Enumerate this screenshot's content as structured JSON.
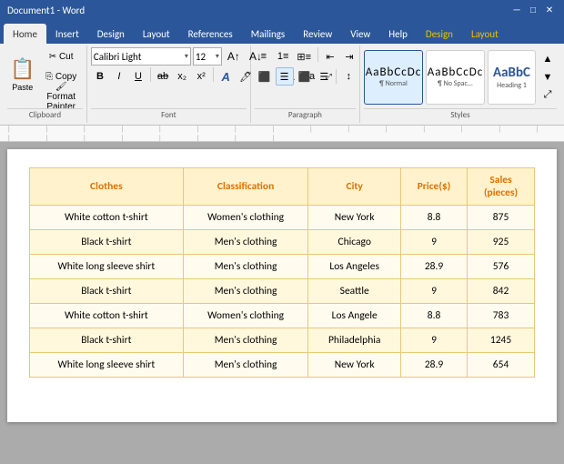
{
  "titlebar": {
    "title": "Document1 - Word",
    "controls": [
      "─",
      "□",
      "✕"
    ]
  },
  "tabs": [
    {
      "label": "Home",
      "active": true
    },
    {
      "label": "Insert",
      "active": false
    },
    {
      "label": "Design",
      "active": false
    },
    {
      "label": "Layout",
      "active": false
    },
    {
      "label": "References",
      "active": false
    },
    {
      "label": "Mailings",
      "active": false
    },
    {
      "label": "Review",
      "active": false
    },
    {
      "label": "View",
      "active": false
    },
    {
      "label": "Help",
      "active": false
    },
    {
      "label": "Design",
      "active": false
    },
    {
      "label": "Layout",
      "active": false
    }
  ],
  "ribbon": {
    "font_name": "Calibri Light",
    "font_size": "12",
    "groups": [
      {
        "label": "Font"
      },
      {
        "label": "Paragraph"
      },
      {
        "label": "Styles"
      }
    ],
    "styles": [
      {
        "label": "¶ Normal",
        "preview": "AaBbCcDc"
      },
      {
        "label": "¶ No Spac...",
        "preview": "AaBbCcDc"
      },
      {
        "label": "Heading 1",
        "preview": "AaBbC"
      }
    ]
  },
  "table": {
    "headers": [
      "Clothes",
      "Classification",
      "City",
      "Price($)",
      "Sales\n(pieces)"
    ],
    "rows": [
      [
        "White cotton t-shirt",
        "Women's clothing",
        "New York",
        "8.8",
        "875"
      ],
      [
        "Black t-shirt",
        "Men's clothing",
        "Chicago",
        "9",
        "925"
      ],
      [
        "White long sleeve shirt",
        "Men's clothing",
        "Los Angeles",
        "28.9",
        "576"
      ],
      [
        "Black t-shirt",
        "Men's clothing",
        "Seattle",
        "9",
        "842"
      ],
      [
        "White cotton t-shirt",
        "Women's clothing",
        "Los Angele",
        "8.8",
        "783"
      ],
      [
        "Black t-shirt",
        "Men's clothing",
        "Philadelphia",
        "9",
        "1245"
      ],
      [
        "White long sleeve shirt",
        "Men's clothing",
        "New York",
        "28.9",
        "654"
      ]
    ]
  }
}
